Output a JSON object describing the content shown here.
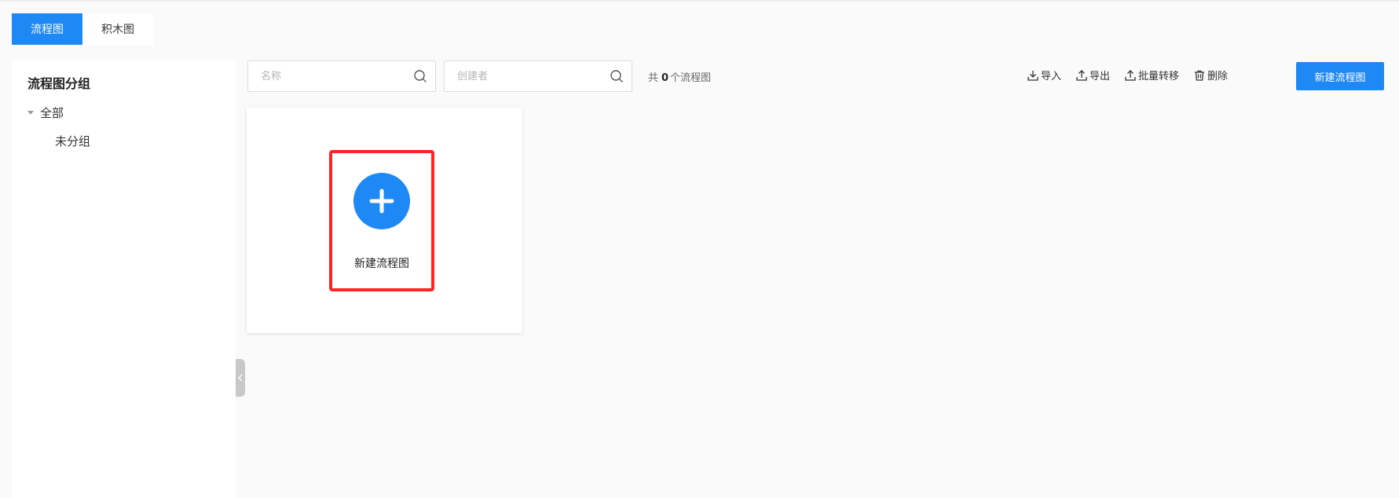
{
  "tabs": [
    {
      "label": "流程图",
      "active": true
    },
    {
      "label": "积木图",
      "active": false
    }
  ],
  "sidebar": {
    "title": "流程图分组",
    "tree": {
      "all_label": "全部",
      "children": [
        {
          "label": "未分组"
        }
      ]
    }
  },
  "toolbar": {
    "name_search": {
      "placeholder": "名称",
      "value": ""
    },
    "creator_search": {
      "placeholder": "创建者",
      "value": ""
    },
    "count": {
      "prefix": "共",
      "value": "0",
      "suffix": "个流程图"
    },
    "actions": {
      "import_label": "导入",
      "export_label": "导出",
      "batch_transfer_label": "批量转移",
      "delete_label": "删除"
    },
    "new_button_label": "新建流程图"
  },
  "card": {
    "label": "新建流程图",
    "icon": "plus-icon"
  },
  "colors": {
    "primary": "#1e88f5",
    "highlight": "#ff2424"
  }
}
